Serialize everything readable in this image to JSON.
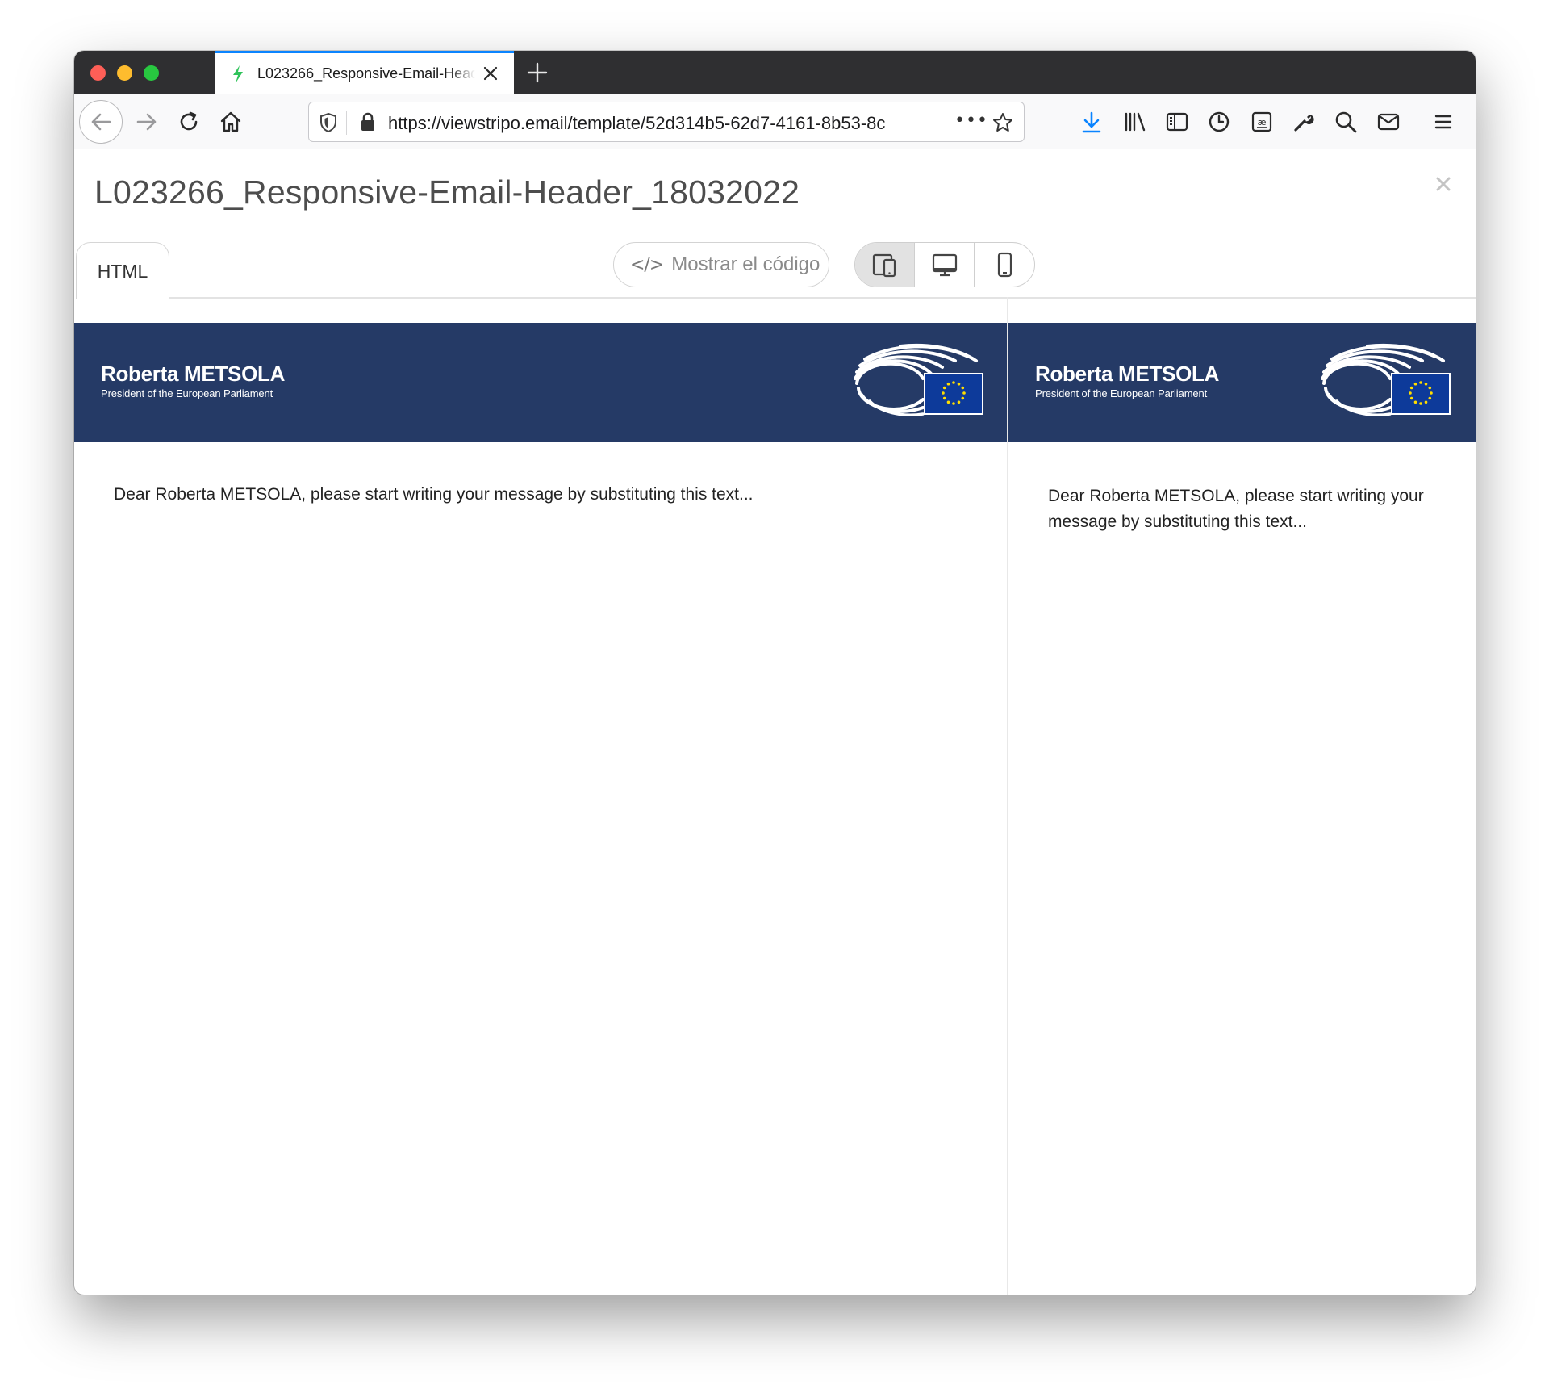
{
  "browser": {
    "tab_title": "L023266_Responsive-Email-Header_18032022",
    "url": "https://viewstripo.email/template/52d314b5-62d7-4161-8b53-8c",
    "url_overflow_indicator": "•••"
  },
  "editor": {
    "title": "L023266_Responsive-Email-Header_18032022",
    "format_tab": "HTML",
    "show_code_label": "Mostrar el código",
    "show_code_icon": "</>",
    "device_modes": [
      "responsive-icon",
      "desktop-icon",
      "mobile-icon"
    ],
    "active_device_mode": "responsive"
  },
  "email": {
    "sender_name": "Roberta METSOLA",
    "sender_title": "President of the European Parliament",
    "message": "Dear Roberta METSOLA, please start writing your message by substituting this text..."
  },
  "colors": {
    "banner": "#253a66",
    "tab_accent": "#0a84ff",
    "download_icon": "#0a84ff",
    "eu_flag": "#0d3a9a",
    "eu_stars": "#ffdd00"
  }
}
